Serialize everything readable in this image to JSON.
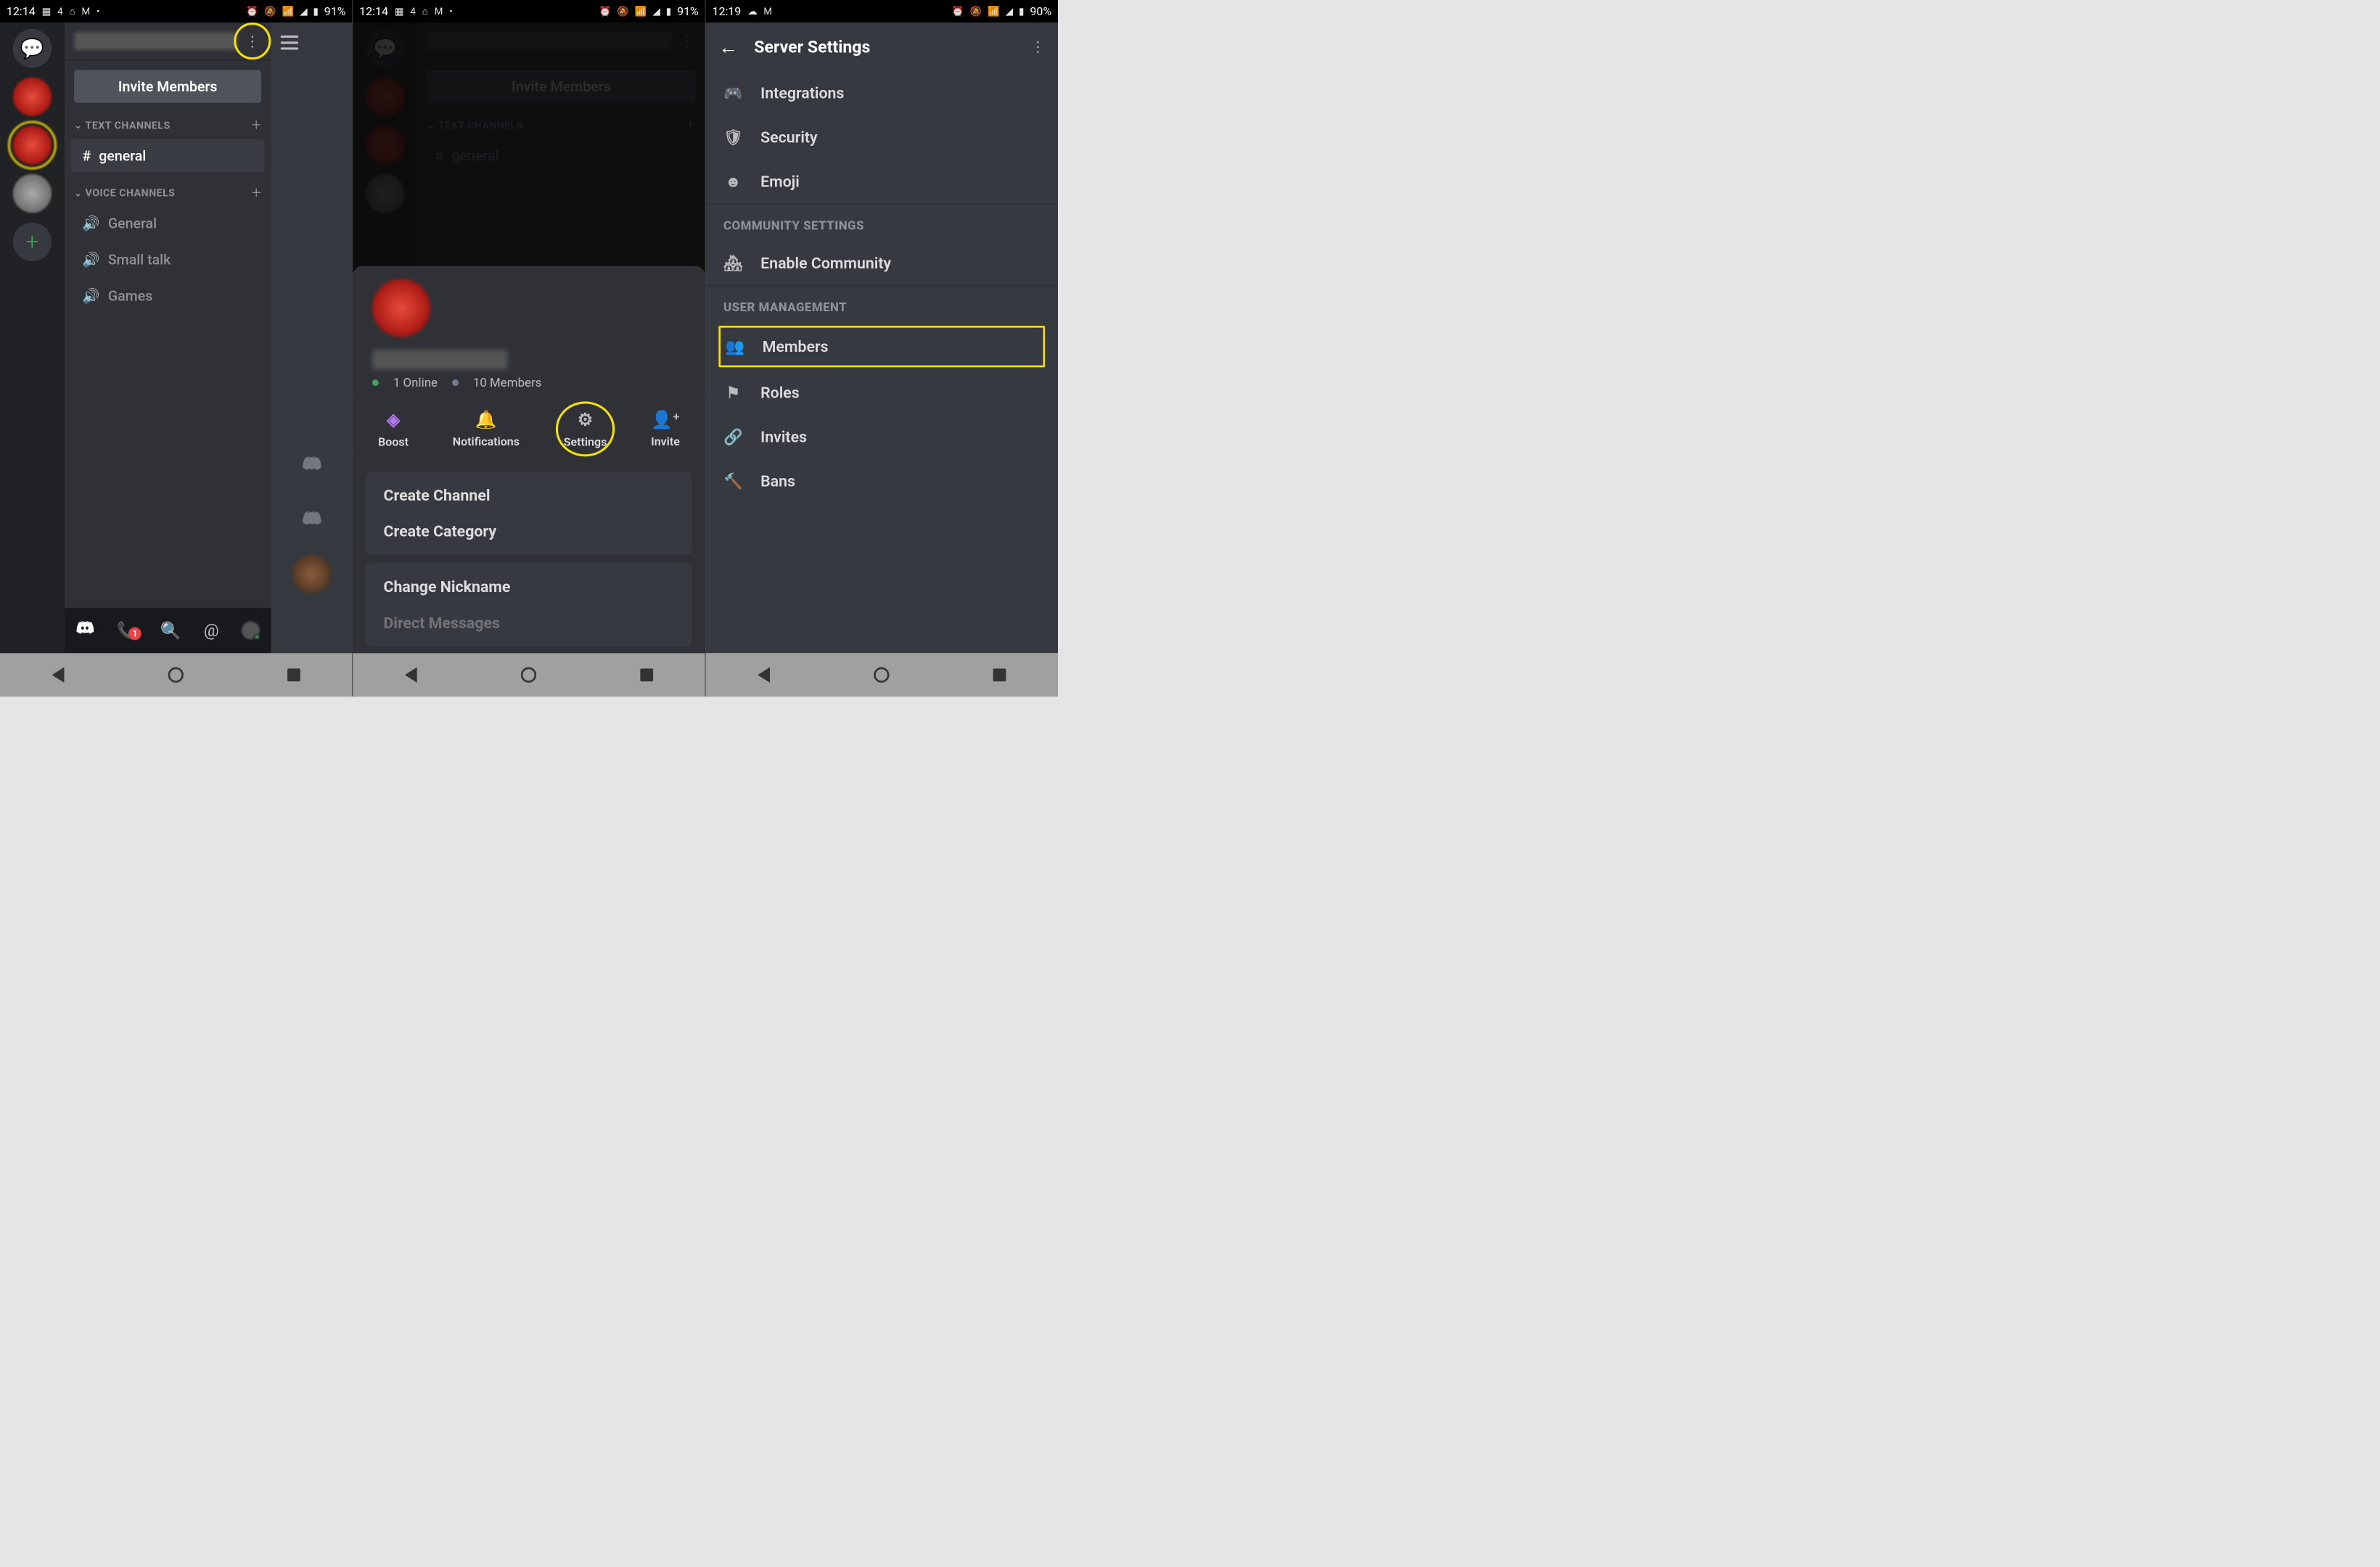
{
  "phone1": {
    "statusbar": {
      "time": "12:14",
      "battery": "91%"
    },
    "server_name_blurred": true,
    "invite_label": "Invite Members",
    "text_channels_header": "TEXT CHANNELS",
    "voice_channels_header": "VOICE CHANNELS",
    "channels": {
      "text": [
        "general"
      ],
      "voice": [
        "General",
        "Small talk",
        "Games"
      ]
    },
    "bottomnav_badge": "1"
  },
  "phone2": {
    "statusbar": {
      "time": "12:14",
      "battery": "91%"
    },
    "invite_label": "Invite Members",
    "text_channels_header": "TEXT CHANNELS",
    "channel_general": "general",
    "online": "1 Online",
    "members": "10 Members",
    "actions": {
      "boost": "Boost",
      "notifications": "Notifications",
      "settings": "Settings",
      "invite": "Invite"
    },
    "menu": {
      "create_channel": "Create Channel",
      "create_category": "Create Category",
      "change_nickname": "Change Nickname",
      "direct_messages": "Direct Messages"
    }
  },
  "phone3": {
    "statusbar": {
      "time": "12:19",
      "battery": "90%"
    },
    "title": "Server Settings",
    "items": {
      "integrations": "Integrations",
      "security": "Security",
      "emoji": "Emoji",
      "community_header": "COMMUNITY SETTINGS",
      "enable_community": "Enable Community",
      "user_mgmt_header": "USER MANAGEMENT",
      "members": "Members",
      "roles": "Roles",
      "invites": "Invites",
      "bans": "Bans"
    }
  }
}
